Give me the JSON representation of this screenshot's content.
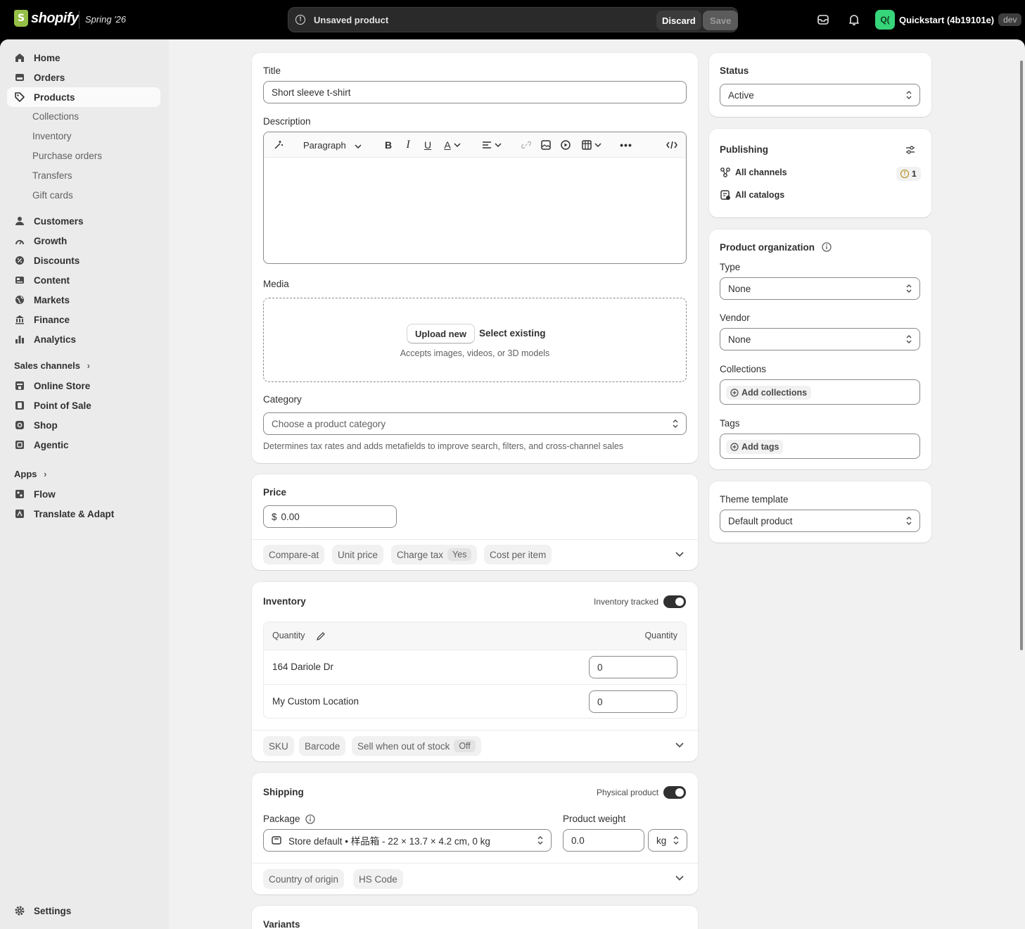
{
  "topbar": {
    "brand": "shopify",
    "edition": "Spring '26",
    "unsaved_message": "Unsaved product",
    "discard_label": "Discard",
    "save_label": "Save",
    "store_initials": "Q(",
    "store_name": "Quickstart (4b19101e)",
    "store_badge": "dev"
  },
  "sidebar": {
    "main_items": [
      {
        "label": "Home",
        "icon": "home-icon"
      },
      {
        "label": "Orders",
        "icon": "orders-icon"
      },
      {
        "label": "Products",
        "icon": "tag-icon",
        "active": true
      }
    ],
    "product_subitems": [
      "Collections",
      "Inventory",
      "Purchase orders",
      "Transfers",
      "Gift cards"
    ],
    "secondary_items": [
      {
        "label": "Customers",
        "icon": "person-icon"
      },
      {
        "label": "Growth",
        "icon": "gauge-icon"
      },
      {
        "label": "Discounts",
        "icon": "discount-icon"
      },
      {
        "label": "Content",
        "icon": "content-icon"
      },
      {
        "label": "Markets",
        "icon": "globe-icon"
      },
      {
        "label": "Finance",
        "icon": "bank-icon"
      },
      {
        "label": "Analytics",
        "icon": "chart-icon"
      }
    ],
    "sales_channels_heading": "Sales channels",
    "sales_channels": [
      {
        "label": "Online Store",
        "icon": "store-icon"
      },
      {
        "label": "Point of Sale",
        "icon": "pos-icon"
      },
      {
        "label": "Shop",
        "icon": "shop-icon"
      },
      {
        "label": "Agentic",
        "icon": "agentic-icon"
      }
    ],
    "apps_heading": "Apps",
    "apps": [
      {
        "label": "Flow",
        "icon": "flow-icon"
      },
      {
        "label": "Translate & Adapt",
        "icon": "translate-icon"
      }
    ],
    "settings_label": "Settings"
  },
  "product": {
    "title_label": "Title",
    "title_value": "Short sleeve t-shirt",
    "description_label": "Description",
    "editor_format": "Paragraph",
    "media_label": "Media",
    "upload_label": "Upload new",
    "select_existing_label": "Select existing",
    "media_hint": "Accepts images, videos, or 3D models",
    "category_label": "Category",
    "category_placeholder": "Choose a product category",
    "category_hint": "Determines tax rates and adds metafields to improve search, filters, and cross-channel sales"
  },
  "price": {
    "heading": "Price",
    "currency": "$",
    "value": "0.00",
    "pills": [
      "Compare-at",
      "Unit price",
      "Charge tax",
      "Cost per item"
    ],
    "charge_tax_value": "Yes"
  },
  "inventory": {
    "heading": "Inventory",
    "tracked_label": "Inventory tracked",
    "col_left": "Quantity",
    "col_right": "Quantity",
    "rows": [
      {
        "location": "164 Dariole Dr",
        "qty": "0"
      },
      {
        "location": "My Custom Location",
        "qty": "0"
      }
    ],
    "pills": [
      "SKU",
      "Barcode",
      "Sell when out of stock"
    ],
    "sell_oos_value": "Off"
  },
  "shipping": {
    "heading": "Shipping",
    "physical_label": "Physical product",
    "package_label": "Package",
    "package_value": "Store default • 样品箱 - 22 × 13.7 × 4.2 cm, 0 kg",
    "weight_label": "Product weight",
    "weight_value": "0.0",
    "weight_unit": "kg",
    "pills": [
      "Country of origin",
      "HS Code"
    ]
  },
  "variants": {
    "heading": "Variants"
  },
  "status": {
    "heading": "Status",
    "value": "Active"
  },
  "publishing": {
    "heading": "Publishing",
    "all_channels": "All channels",
    "channels_count": "1",
    "all_catalogs": "All catalogs"
  },
  "organization": {
    "heading": "Product organization",
    "type_label": "Type",
    "type_value": "None",
    "vendor_label": "Vendor",
    "vendor_value": "None",
    "collections_label": "Collections",
    "add_collections": "Add collections",
    "tags_label": "Tags",
    "add_tags": "Add tags"
  },
  "theme": {
    "label": "Theme template",
    "value": "Default product"
  },
  "colors": {
    "accent": "#303030",
    "brand_green": "#95bf47",
    "avatar_green": "#36d57a",
    "warning": "#b28400"
  }
}
